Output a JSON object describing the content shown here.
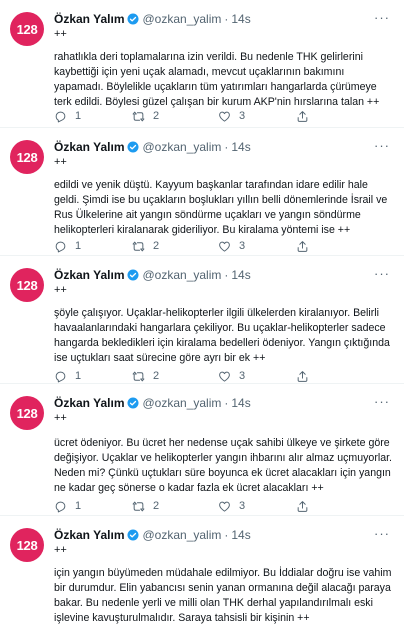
{
  "author": {
    "name": "Özkan Yalım",
    "handle": "@ozkan_yalim",
    "avatar_text": "128",
    "avatar_color": "#e0245e",
    "verified_color": "#1d9bf0"
  },
  "tweets": [
    {
      "time": "14s",
      "prefix": "++",
      "text": "rahatlıkla deri toplamalarına izin verildi. Bu nedenle THK gelirlerini kaybettiği için yeni uçak alamadı, mevcut uçaklarının bakımını yapamadı. Böylelikle uçakların tüm yatırımları hangarlarda çürümeye terk edildi. Böylesi güzel çalışan bir kurum AKP'nin hırslarına talan ++",
      "replies": "1",
      "retweets": "2",
      "likes": "3"
    },
    {
      "time": "14s",
      "prefix": "++",
      "text": "edildi ve yenik düştü. Kayyum başkanlar tarafından idare edilir hale geldi. Şimdi ise bu uçakların boşlukları yıllın belli dönemlerinde İsrail ve Rus Ülkelerine ait yangın söndürme uçakları ve yangın söndürme helikopterleri kiralanarak gideriliyor. Bu kiralama yöntemi ise ++",
      "replies": "1",
      "retweets": "2",
      "likes": "3"
    },
    {
      "time": "14s",
      "prefix": "++",
      "text": "şöyle çalışıyor. Uçaklar-helikopterler ilgili ülkelerden kiralanıyor. Belirli havaalanlarındaki  hangarlara çekiliyor. Bu uçaklar-helikopterler sadece hangarda bekledikleri için kiralama bedelleri ödeniyor. Yangın çıktığında ise uçtukları saat sürecine göre ayrı bir ek ++",
      "replies": "1",
      "retweets": "2",
      "likes": "3"
    },
    {
      "time": "14s",
      "prefix": "++",
      "text": "ücret ödeniyor. Bu ücret her nedense uçak sahibi ülkeye ve şirkete göre değişiyor. Uçaklar ve helikopterler yangın ihbarını alır almaz uçmuyorlar. Neden mi? Çünkü uçtukları süre boyunca ek ücret alacakları için yangın ne kadar geç sönerse o kadar fazla ek ücret alacakları ++",
      "replies": "1",
      "retweets": "2",
      "likes": "3"
    },
    {
      "time": "14s",
      "prefix": "++",
      "text": "için yangın büyümeden müdahale edilmiyor. Bu İddialar doğru ise vahim bir durumdur. Elin yabancısı senin yanan ormanına değil alacağı paraya bakar. Bu nedenle yerli ve milli olan THK derhal yapılandırılmalı eski işlevine kavuşturulmalıdır. Saraya tahsisli bir kişinin ++",
      "replies": "",
      "retweets": "",
      "likes": ""
    }
  ]
}
